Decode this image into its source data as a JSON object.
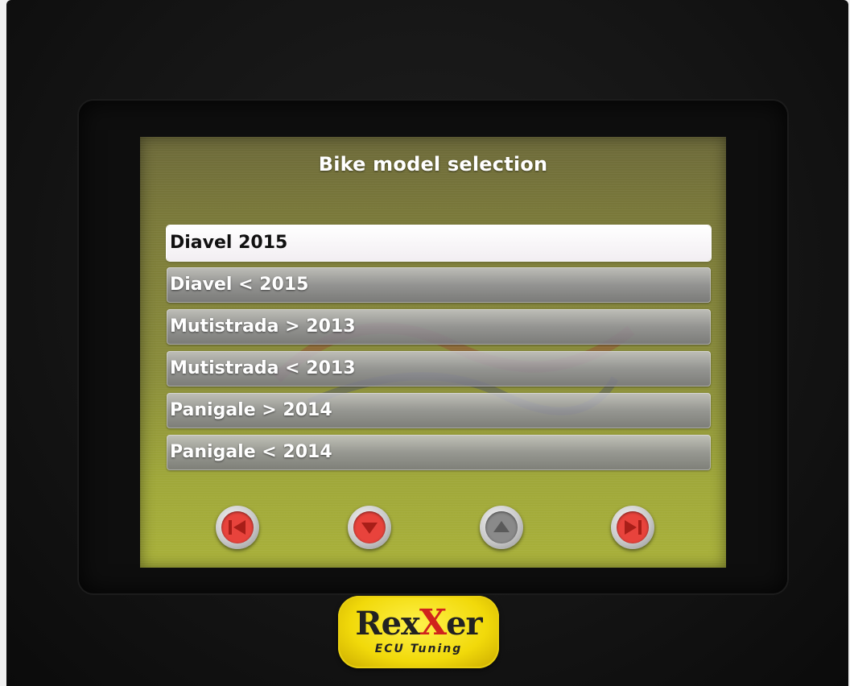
{
  "screen": {
    "title": "Bike model selection",
    "models": [
      {
        "label": "Diavel 2015",
        "selected": true
      },
      {
        "label": "Diavel < 2015",
        "selected": false
      },
      {
        "label": "Mutistrada > 2013",
        "selected": false
      },
      {
        "label": "Mutistrada < 2013",
        "selected": false
      },
      {
        "label": "Panigale > 2014",
        "selected": false
      },
      {
        "label": "Panigale < 2014",
        "selected": false
      }
    ],
    "nav_buttons": [
      {
        "icon": "back-icon",
        "color": "#e8433c"
      },
      {
        "icon": "down-arrow-icon",
        "color": "#e8433c"
      },
      {
        "icon": "up-arrow-icon",
        "color": "#8a8a8a"
      },
      {
        "icon": "forward-icon",
        "color": "#e8433c"
      }
    ]
  },
  "brand": {
    "name_part1": "Rex",
    "name_x": "X",
    "name_part2": "er",
    "tagline": "ECU Tuning"
  }
}
